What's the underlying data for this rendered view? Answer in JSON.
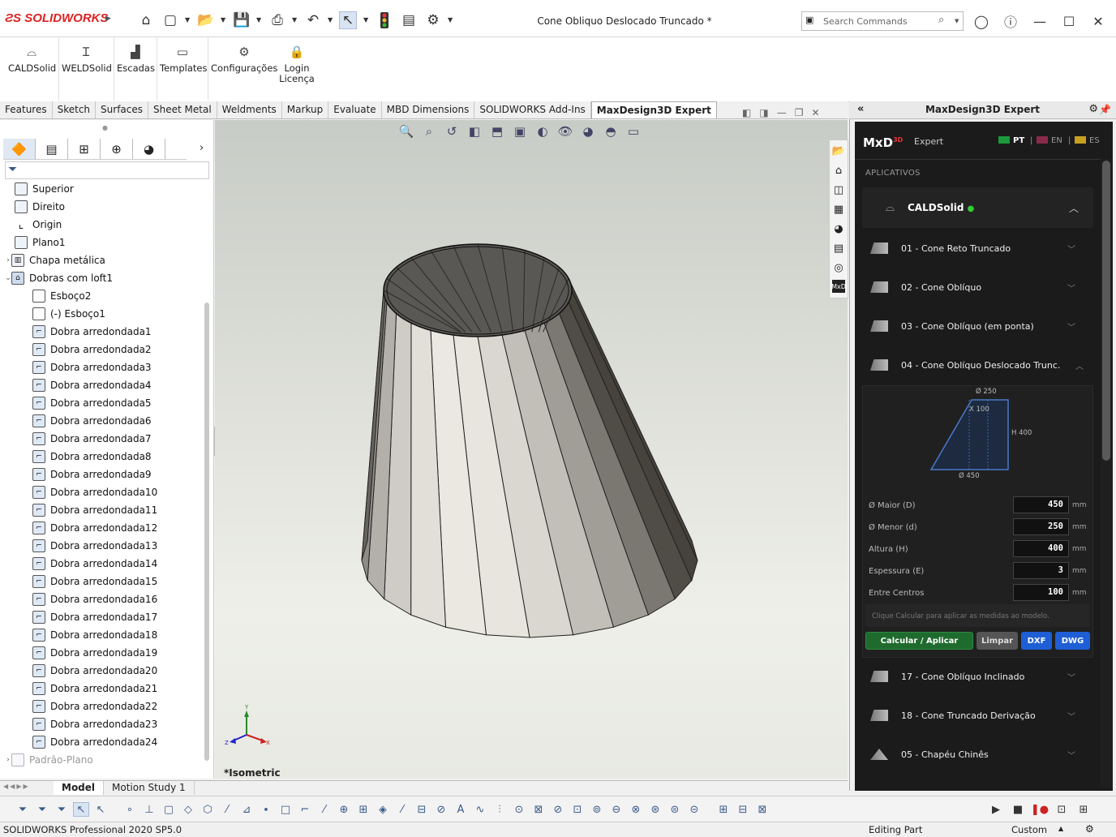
{
  "app": {
    "brand": "SOLIDWORKS",
    "doc_title": "Cone Obliquo Deslocado Truncado *"
  },
  "search": {
    "placeholder": "Search Commands"
  },
  "command_manager": {
    "items": [
      "CALDSolid",
      "WELDSolid",
      "Escadas",
      "Templates",
      "Configurações",
      "Login\nLicença"
    ]
  },
  "tabs": [
    "Features",
    "Sketch",
    "Surfaces",
    "Sheet Metal",
    "Weldments",
    "Markup",
    "Evaluate",
    "MBD Dimensions",
    "SOLIDWORKS Add-Ins",
    "MaxDesign3D Expert"
  ],
  "active_tab": "MaxDesign3D Expert",
  "tree": {
    "items": [
      "Superior",
      "Direito",
      "Origin",
      "Plano1",
      "Chapa metálica",
      "Dobras com loft1",
      "Esboço2",
      "(-) Esboço1",
      "Dobra arredondada1",
      "Dobra arredondada2",
      "Dobra arredondada3",
      "Dobra arredondada4",
      "Dobra arredondada5",
      "Dobra arredondada6",
      "Dobra arredondada7",
      "Dobra arredondada8",
      "Dobra arredondada9",
      "Dobra arredondada10",
      "Dobra arredondada11",
      "Dobra arredondada12",
      "Dobra arredondada13",
      "Dobra arredondada14",
      "Dobra arredondada15",
      "Dobra arredondada16",
      "Dobra arredondada17",
      "Dobra arredondada18",
      "Dobra arredondada19",
      "Dobra arredondada20",
      "Dobra arredondada21",
      "Dobra arredondada22",
      "Dobra arredondada23",
      "Dobra arredondada24",
      "Padrão-Plano"
    ]
  },
  "viewport": {
    "view_label": "*Isometric",
    "triad": {
      "x": "X",
      "y": "Y",
      "z": "Z"
    }
  },
  "right_pane": {
    "title": "MaxDesign3D Expert",
    "mxd": {
      "logo": "MxD",
      "logo_sup": "3D",
      "subtitle": "Expert",
      "langs": [
        "PT",
        "EN",
        "ES"
      ],
      "section": "APLICATIVOS"
    },
    "caldsolid": "CALDSolid",
    "items": [
      "01 - Cone Reto Truncado",
      "02 - Cone Oblíquo",
      "03 - Cone Oblíquo (em ponta)",
      "04 - Cone Oblíquo Deslocado Trunc.",
      "17 - Cone Oblíquo Inclinado",
      "18 - Cone Truncado Derivação",
      "05 - Chapéu Chinês"
    ],
    "diagram": {
      "top": "Ø 250",
      "offset": "X 100",
      "height": "H 400",
      "bottom": "Ø 450"
    },
    "fields": [
      {
        "label": "Ø Maior (D)",
        "value": "450",
        "unit": "mm"
      },
      {
        "label": "Ø Menor (d)",
        "value": "250",
        "unit": "mm"
      },
      {
        "label": "Altura (H)",
        "value": "400",
        "unit": "mm"
      },
      {
        "label": "Espessura (E)",
        "value": "3",
        "unit": "mm"
      },
      {
        "label": "Entre Centros",
        "value": "100",
        "unit": "mm"
      }
    ],
    "hint": "Clique Calcular para aplicar as medidas ao modelo.",
    "buttons": {
      "calc": "Calcular / Aplicar",
      "clear": "Limpar",
      "dxf": "DXF",
      "dwg": "DWG"
    },
    "colors": {
      "calc": "#1f6b2e",
      "dxf": "#1f5fd6",
      "dwg": "#1f5fd6",
      "clear": "#555555"
    }
  },
  "bottom_tabs": [
    "Model",
    "Motion Study 1"
  ],
  "status": {
    "left": "SOLIDWORKS Professional 2020 SP5.0",
    "mode": "Editing Part",
    "units": "Custom"
  }
}
